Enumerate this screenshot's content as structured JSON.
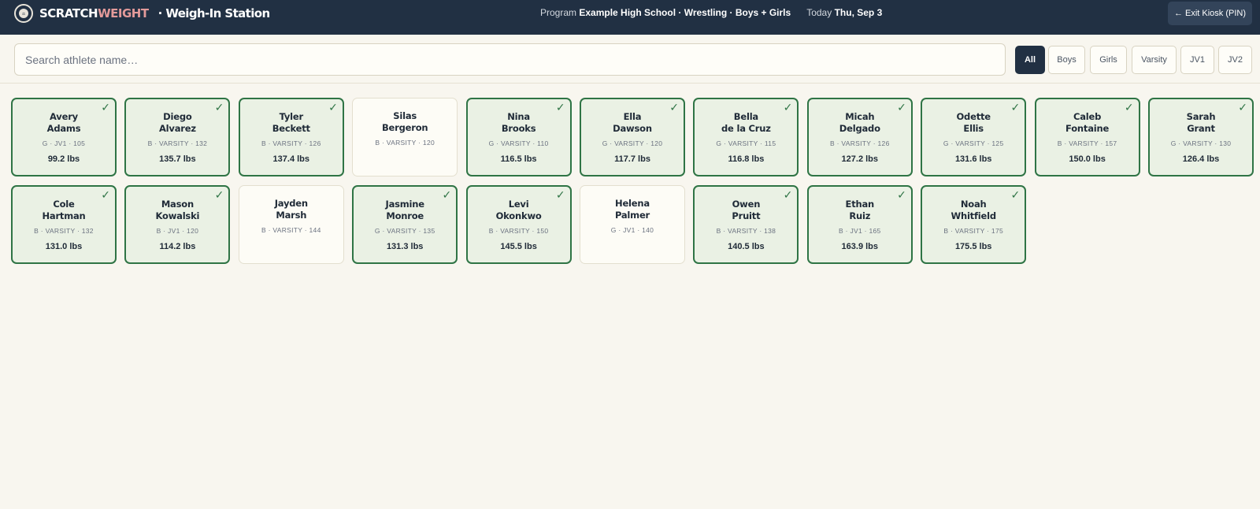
{
  "header": {
    "brand_part1": "SCRATCH",
    "brand_part2": "WEIGHT",
    "station_title": "· Weigh-In Station",
    "program_label": "Program",
    "program_value": "Example High School · Wrestling · Boys + Girls",
    "today_label": "Today",
    "today_value": "Thu, Sep 3",
    "exit_button": "← Exit Kiosk (PIN)",
    "logo_icon": "scale-logo-icon"
  },
  "search": {
    "placeholder": "Search athlete name…",
    "value": ""
  },
  "filters": [
    {
      "label": "All",
      "active": true
    },
    {
      "label": "Boys",
      "active": false
    },
    {
      "label": "Girls",
      "active": false
    },
    {
      "label": "Varsity",
      "active": false
    },
    {
      "label": "JV1",
      "active": false
    },
    {
      "label": "JV2",
      "active": false
    }
  ],
  "colors": {
    "header_bg": "#213043",
    "accent_red": "#e39a9a",
    "weighed_border": "#2f7445",
    "weighed_bg": "#eaf1e4",
    "pending_bg": "#fdfcf6"
  },
  "athletes": [
    {
      "first": "Avery",
      "last": "Adams",
      "meta": "G · JV1 · 105",
      "weight": "99.2 lbs",
      "weighed": true
    },
    {
      "first": "Diego",
      "last": "Alvarez",
      "meta": "B · VARSITY · 132",
      "weight": "135.7 lbs",
      "weighed": true
    },
    {
      "first": "Tyler",
      "last": "Beckett",
      "meta": "B · VARSITY · 126",
      "weight": "137.4 lbs",
      "weighed": true
    },
    {
      "first": "Silas",
      "last": "Bergeron",
      "meta": "B · VARSITY · 120",
      "weight": "",
      "weighed": false
    },
    {
      "first": "Nina",
      "last": "Brooks",
      "meta": "G · VARSITY · 110",
      "weight": "116.5 lbs",
      "weighed": true
    },
    {
      "first": "Ella",
      "last": "Dawson",
      "meta": "G · VARSITY · 120",
      "weight": "117.7 lbs",
      "weighed": true
    },
    {
      "first": "Bella",
      "last": "de la Cruz",
      "meta": "G · VARSITY · 115",
      "weight": "116.8 lbs",
      "weighed": true
    },
    {
      "first": "Micah",
      "last": "Delgado",
      "meta": "B · VARSITY · 126",
      "weight": "127.2 lbs",
      "weighed": true
    },
    {
      "first": "Odette",
      "last": "Ellis",
      "meta": "G · VARSITY · 125",
      "weight": "131.6 lbs",
      "weighed": true
    },
    {
      "first": "Caleb",
      "last": "Fontaine",
      "meta": "B · VARSITY · 157",
      "weight": "150.0 lbs",
      "weighed": true
    },
    {
      "first": "Sarah",
      "last": "Grant",
      "meta": "G · VARSITY · 130",
      "weight": "126.4 lbs",
      "weighed": true
    },
    {
      "first": "Cole",
      "last": "Hartman",
      "meta": "B · VARSITY · 132",
      "weight": "131.0 lbs",
      "weighed": true
    },
    {
      "first": "Mason",
      "last": "Kowalski",
      "meta": "B · JV1 · 120",
      "weight": "114.2 lbs",
      "weighed": true
    },
    {
      "first": "Jayden",
      "last": "Marsh",
      "meta": "B · VARSITY · 144",
      "weight": "",
      "weighed": false
    },
    {
      "first": "Jasmine",
      "last": "Monroe",
      "meta": "G · VARSITY · 135",
      "weight": "131.3 lbs",
      "weighed": true
    },
    {
      "first": "Levi",
      "last": "Okonkwo",
      "meta": "B · VARSITY · 150",
      "weight": "145.5 lbs",
      "weighed": true
    },
    {
      "first": "Helena",
      "last": "Palmer",
      "meta": "G · JV1 · 140",
      "weight": "",
      "weighed": false
    },
    {
      "first": "Owen",
      "last": "Pruitt",
      "meta": "B · VARSITY · 138",
      "weight": "140.5 lbs",
      "weighed": true
    },
    {
      "first": "Ethan",
      "last": "Ruiz",
      "meta": "B · JV1 · 165",
      "weight": "163.9 lbs",
      "weighed": true
    },
    {
      "first": "Noah",
      "last": "Whitfield",
      "meta": "B · VARSITY · 175",
      "weight": "175.5 lbs",
      "weighed": true
    }
  ]
}
